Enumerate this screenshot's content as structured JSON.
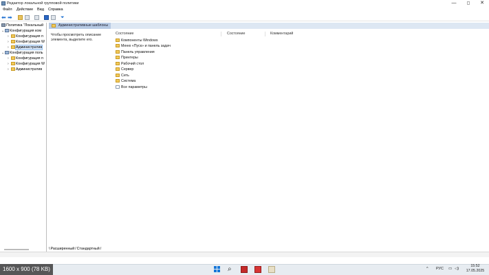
{
  "window": {
    "title": "Редактор локальной групповой политики",
    "controls": {
      "minimize": "—",
      "maximize": "◻",
      "close": "✕"
    }
  },
  "menu": [
    "Файл",
    "Действие",
    "Вид",
    "Справка"
  ],
  "toolbar": {
    "icons": [
      "back-arrow-icon",
      "forward-arrow-icon",
      "up-folder-icon",
      "show-hide-tree-icon",
      "export-list-icon",
      "help-icon",
      "properties-icon",
      "filter-icon"
    ]
  },
  "tree": {
    "items": [
      {
        "label": "Политика \"Локальный",
        "expander": "",
        "icon": "policy"
      },
      {
        "label": "Конфигурация ком",
        "expander": "⌄",
        "icon": "computer"
      },
      {
        "label": "Конфигурация п",
        "expander": "›",
        "icon": "folder"
      },
      {
        "label": "Конфигурация W",
        "expander": "›",
        "icon": "folder"
      },
      {
        "label": "Административ",
        "expander": "›",
        "icon": "folder",
        "selected": true
      },
      {
        "label": "Конфигурация поль",
        "expander": "⌄",
        "icon": "computer"
      },
      {
        "label": "Конфигурация п",
        "expander": "›",
        "icon": "folder"
      },
      {
        "label": "Конфигурация W",
        "expander": "›",
        "icon": "folder"
      },
      {
        "label": "Административ",
        "expander": "›",
        "icon": "folder"
      }
    ]
  },
  "content": {
    "header": "Административные шаблоны",
    "description": "Чтобы просмотреть описание элемента, выделите его.",
    "columns": [
      "Состояние",
      "Состояние",
      "Комментарий"
    ],
    "items": [
      {
        "label": "Компоненты Windows",
        "icon": "folder"
      },
      {
        "label": "Меню «Пуск» и панель задач",
        "icon": "folder"
      },
      {
        "label": "Панель управления",
        "icon": "folder"
      },
      {
        "label": "Принтеры",
        "icon": "folder"
      },
      {
        "label": "Рабочий стол",
        "icon": "folder"
      },
      {
        "label": "Сервер",
        "icon": "folder"
      },
      {
        "label": "Сеть",
        "icon": "folder"
      },
      {
        "label": "Система",
        "icon": "folder"
      },
      {
        "label": "Все параметры",
        "icon": "settings"
      }
    ]
  },
  "tabs": [
    "Расширенный",
    "Стандартный"
  ],
  "overlay": {
    "size_label": "1600 x 900 (78 KB)"
  },
  "taskbar": {
    "icons": [
      "windows-start-icon",
      "search-icon",
      "app-red-icon",
      "app-red2-icon",
      "app-beige-icon"
    ],
    "tray": {
      "chevron": "^",
      "lang": "РУС",
      "display": "▭",
      "volume": "◁)"
    },
    "time": "15:52",
    "date": "17.05.2025"
  }
}
